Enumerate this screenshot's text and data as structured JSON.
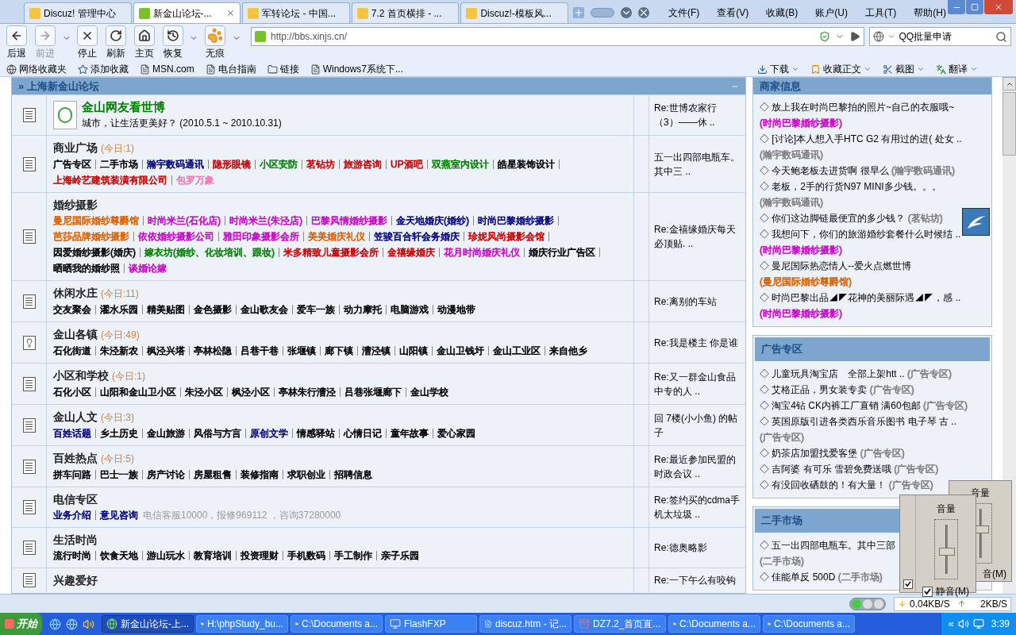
{
  "tabs": [
    {
      "label": "Discuz! 管理中心",
      "selected": false
    },
    {
      "label": "新金山论坛-...",
      "selected": true
    },
    {
      "label": "军转论坛 - 中国...",
      "selected": false
    },
    {
      "label": "7.2 首页横排 - ...",
      "selected": false
    },
    {
      "label": "Discuz!-模板风...",
      "selected": false
    }
  ],
  "menu": [
    "文件(F)",
    "查看(V)",
    "收藏(B)",
    "账户(U)",
    "工具(T)",
    "帮助(H)"
  ],
  "toolbar": [
    {
      "kind": "back",
      "label": "后退",
      "disabled": false
    },
    {
      "kind": "forward",
      "label": "前进",
      "disabled": true
    },
    {
      "kind": "stop",
      "label": "停止",
      "disabled": false
    },
    {
      "kind": "refresh",
      "label": "刷新",
      "disabled": false
    },
    {
      "kind": "home",
      "label": "主页",
      "disabled": false
    },
    {
      "kind": "restore",
      "label": "恢复",
      "disabled": false
    },
    {
      "kind": "private",
      "label": "无痕",
      "disabled": false
    }
  ],
  "address": {
    "value": "http://bbs.xinjs.cn/"
  },
  "search": {
    "value": "QQ批量申请"
  },
  "favorites_left": [
    {
      "kind": "net",
      "label": "网络收藏夹"
    },
    {
      "kind": "add",
      "label": "添加收藏"
    },
    {
      "kind": "page",
      "label": "MSN.com"
    },
    {
      "kind": "page",
      "label": "电台指南"
    },
    {
      "kind": "folder",
      "label": "链接"
    },
    {
      "kind": "page",
      "label": "Windows7系统下..."
    }
  ],
  "favorites_right": [
    {
      "kind": "download",
      "label": "下载"
    },
    {
      "kind": "save",
      "label": "收藏正文"
    },
    {
      "kind": "capture",
      "label": "截图"
    },
    {
      "kind": "translate",
      "label": "翻译"
    }
  ],
  "forum": {
    "title": "» 上海新金山论坛",
    "rows": [
      {
        "kind": "expo",
        "has_new": false,
        "title": "金山网友看世博",
        "description": "城市，让生活更美好？ (2010.5.1 ~ 2010.10.31)",
        "last_post": "Re:世博农家行（3）——休 .."
      },
      {
        "kind": "normal",
        "has_new": false,
        "title": "商业广场",
        "today": "(今日:1)",
        "last_post": "五一出四部电瓶车。其中三 ..",
        "links": [
          {
            "label": "广告专区",
            "color": "#000000"
          },
          {
            "label": "二手市场",
            "color": "#000000"
          },
          {
            "label": "瀚宇数码通讯",
            "color": "#000080"
          },
          {
            "label": "隐形眼镜",
            "color": "#cc0000"
          },
          {
            "label": "小区安防",
            "color": "#008000"
          },
          {
            "label": "茗钻坊",
            "color": "#cc0000"
          },
          {
            "label": "旅游咨询",
            "color": "#cc0000"
          },
          {
            "label": "UP酒吧",
            "color": "#cc0000"
          },
          {
            "label": "双燕室内设计",
            "color": "#008000"
          },
          {
            "label": "皓星装饰设计",
            "color": "#000000"
          },
          {
            "label": "上海岭艺建筑装潢有限公司",
            "color": "#cc0000"
          },
          {
            "label": "包罗万象",
            "color": "#e87ab5"
          }
        ]
      },
      {
        "kind": "normal",
        "has_new": false,
        "title": "婚纱摄影",
        "last_post": "Re:金禧缘婚庆每天必顶贴. ..",
        "links": [
          {
            "label": "曼尼国际婚纱尊爵馆",
            "color": "#e06000"
          },
          {
            "label": "时尚米兰(石化店)",
            "color": "#cc00cc"
          },
          {
            "label": "时尚米兰(朱泾店)",
            "color": "#cc00cc"
          },
          {
            "label": "巴黎风情婚纱摄影",
            "color": "#cc00cc"
          },
          {
            "label": "金天地婚庆(婚纱)",
            "color": "#000080"
          },
          {
            "label": "时尚巴黎婚纱摄影",
            "color": "#000080"
          },
          {
            "label": "芭莎品牌婚纱摄影",
            "color": "#e06000"
          },
          {
            "label": "依依婚纱摄影公司",
            "color": "#cc00cc"
          },
          {
            "label": "雅田印象摄影会所",
            "color": "#cc00cc"
          },
          {
            "label": "美美婚庆礼仪",
            "color": "#e06000"
          },
          {
            "label": "笠骏百合轩会务婚庆",
            "color": "#000080"
          },
          {
            "label": "珍妮风尚摄影会馆",
            "color": "#cc0000"
          },
          {
            "label": "因爱婚纱摄影(婚庆)",
            "color": "#000000"
          },
          {
            "label": "嫁衣坊(婚纱、化妆培训、跟妆)",
            "color": "#008000"
          },
          {
            "label": "米多精致儿童摄影会所",
            "color": "#cc0000"
          },
          {
            "label": "金禧缘婚庆",
            "color": "#cc0000"
          },
          {
            "label": "花月时尚婚庆礼仪",
            "color": "#cc00cc"
          },
          {
            "label": "婚庆行业广告区",
            "color": "#000000"
          },
          {
            "label": "晒晒我的婚纱照",
            "color": "#000000"
          },
          {
            "label": "谈婚论嫁",
            "color": "#cc00cc"
          }
        ]
      },
      {
        "kind": "normal",
        "has_new": false,
        "title": "休闲水庄",
        "today": "(今日:11)",
        "last_post": "Re:离别的车站",
        "links": [
          {
            "label": "交友聚会",
            "color": "#000000"
          },
          {
            "label": "濯水乐园",
            "color": "#000000"
          },
          {
            "label": "精美贴图",
            "color": "#000000"
          },
          {
            "label": "金色摄影",
            "color": "#000000"
          },
          {
            "label": "金山歌友会",
            "color": "#000000"
          },
          {
            "label": "爱车一族",
            "color": "#000000"
          },
          {
            "label": "动力摩托",
            "color": "#000000"
          },
          {
            "label": "电脑游戏",
            "color": "#000000"
          },
          {
            "label": "动漫地带",
            "color": "#000000"
          }
        ]
      },
      {
        "kind": "normal",
        "has_new": true,
        "title": "金山各镇",
        "today": "(今日:49)",
        "last_post": "Re:我是楼主 你是谁",
        "links": [
          {
            "label": "石化街道",
            "color": "#000000"
          },
          {
            "label": "朱泾新农",
            "color": "#000000"
          },
          {
            "label": "枫泾兴塔",
            "color": "#000000"
          },
          {
            "label": "亭林松隐",
            "color": "#000000"
          },
          {
            "label": "吕巷干巷",
            "color": "#000000"
          },
          {
            "label": "张堰镇",
            "color": "#000000"
          },
          {
            "label": "廊下镇",
            "color": "#000000"
          },
          {
            "label": "漕泾镇",
            "color": "#000000"
          },
          {
            "label": "山阳镇",
            "color": "#000000"
          },
          {
            "label": "金山卫钱圩",
            "color": "#000000"
          },
          {
            "label": "金山工业区",
            "color": "#000000"
          },
          {
            "label": "来自他乡",
            "color": "#000000"
          }
        ]
      },
      {
        "kind": "normal",
        "has_new": false,
        "title": "小区和学校",
        "today": "(今日:1)",
        "last_post": "Re:又一群金山食品中专的人 ..",
        "links": [
          {
            "label": "石化小区",
            "color": "#000000"
          },
          {
            "label": "山阳和金山卫小区",
            "color": "#000000"
          },
          {
            "label": "朱泾小区",
            "color": "#000000"
          },
          {
            "label": "枫泾小区",
            "color": "#000000"
          },
          {
            "label": "亭林朱行漕泾",
            "color": "#000000"
          },
          {
            "label": "吕巷张堰廊下",
            "color": "#000000"
          },
          {
            "label": "金山学校",
            "color": "#000000"
          }
        ]
      },
      {
        "kind": "normal",
        "has_new": false,
        "title": "金山人文",
        "today": "(今日:3)",
        "last_post": "回 7楼(小小鱼) 的帖子",
        "links": [
          {
            "label": "百姓话题",
            "color": "#000080"
          },
          {
            "label": "乡土历史",
            "color": "#000000"
          },
          {
            "label": "金山旅游",
            "color": "#000000"
          },
          {
            "label": "风俗与方言",
            "color": "#000000"
          },
          {
            "label": "原创文学",
            "color": "#000080"
          },
          {
            "label": "情感驿站",
            "color": "#000000"
          },
          {
            "label": "心情日记",
            "color": "#000000"
          },
          {
            "label": "童年故事",
            "color": "#000000"
          },
          {
            "label": "爱心家园",
            "color": "#000000"
          }
        ]
      },
      {
        "kind": "normal",
        "has_new": false,
        "title": "百姓热点",
        "today": "(今日:5)",
        "last_post": "Re:最近参加民盟的时政会议 ..",
        "links": [
          {
            "label": "拼车问路",
            "color": "#000000"
          },
          {
            "label": "巴士一族",
            "color": "#000000"
          },
          {
            "label": "房产讨论",
            "color": "#000000"
          },
          {
            "label": "房屋租售",
            "color": "#000000"
          },
          {
            "label": "装修指南",
            "color": "#000000"
          },
          {
            "label": "求职创业",
            "color": "#000000"
          },
          {
            "label": "招聘信息",
            "color": "#000000"
          }
        ]
      },
      {
        "kind": "normal",
        "has_new": false,
        "title": "电信专区",
        "note": "电信客服10000，报修969112 ，咨询37280000",
        "last_post": "Re:签约买的cdma手机太垃圾 ..",
        "links": [
          {
            "label": "业务介绍",
            "color": "#000080"
          },
          {
            "label": "意见咨询",
            "color": "#000080"
          }
        ]
      },
      {
        "kind": "normal",
        "has_new": false,
        "title": "生活时尚",
        "last_post": "Re:德奥略影",
        "links": [
          {
            "label": "流行时尚",
            "color": "#000000"
          },
          {
            "label": "饮食天地",
            "color": "#000000"
          },
          {
            "label": "游山玩水",
            "color": "#000000"
          },
          {
            "label": "教育培训",
            "color": "#000000"
          },
          {
            "label": "投资理财",
            "color": "#000000"
          },
          {
            "label": "手机数码",
            "color": "#000000"
          },
          {
            "label": "手工制作",
            "color": "#000000"
          },
          {
            "label": "亲子乐园",
            "color": "#000000"
          }
        ]
      },
      {
        "kind": "normal",
        "has_new": false,
        "title": "兴趣爱好",
        "last_post": "Re:一下午么有咬钩"
      }
    ]
  },
  "sidebar": [
    {
      "title": "商家信息",
      "items": [
        {
          "text": "◇ 放上我在时尚巴黎拍的照片~自己的衣服哦~",
          "source": "(时尚巴黎婚纱摄影)",
          "color": "#cc00cc"
        },
        {
          "text": "◇ [讨论]本人想入手HTC G2 有用过的进( 处女 ..",
          "source": "(瀚宇数码通讯)",
          "color": "#808080"
        },
        {
          "text": "◇ 今天鲍老板去进货啊 很早么",
          "source": "(瀚宇数码通讯)",
          "color": "#808080"
        },
        {
          "text": "◇ 老板，2手的行货N97 MINI多少钱。。。",
          "source": "(瀚宇数码通讯)",
          "color": "#808080"
        },
        {
          "text": "◇ 你们这边脚链最便宜的多少钱？",
          "source": "(茗钻坊)",
          "color": "#808080"
        },
        {
          "text": "◇ 我想问下，你们的旅游婚纱套餐什么时候结 ..",
          "source": "(时尚巴黎婚纱摄影)",
          "color": "#cc00cc"
        },
        {
          "text": "◇ 曼尼国际热恋情人--爱火点燃世博",
          "source": "(曼尼国际婚纱尊爵馆)",
          "color": "#e06000"
        },
        {
          "text": "◇ 时尚巴黎出品◢◤花神的美丽际遇◢◤，感 ..",
          "source": "(时尚巴黎婚纱摄影)",
          "color": "#cc00cc"
        }
      ]
    },
    {
      "title": "广告专区",
      "items": [
        {
          "text": "◇ 儿童玩具淘宝店　全部上架htt ..",
          "source": "(广告专区)",
          "color": "#808080"
        },
        {
          "text": "◇ 艾格正品，男女装专卖",
          "source": "(广告专区)",
          "color": "#808080"
        },
        {
          "text": "◇ 淘宝4钻 CK内裤工厂直销 满60包邮",
          "source": "(广告专区)",
          "color": "#808080"
        },
        {
          "text": "◇ 英国原版引进各类西乐音乐图书 电子琴 古 ..",
          "source": "(广告专区)",
          "color": "#808080"
        },
        {
          "text": "◇ 奶茶店加盟找爱客堡",
          "source": "(广告专区)",
          "color": "#808080"
        },
        {
          "text": "◇ 吉阿婆 有可乐 雪碧免费送哦",
          "source": "(广告专区)",
          "color": "#808080"
        },
        {
          "text": "◇ 有没回收硒鼓的！有大量！",
          "source": "(广告专区)",
          "color": "#808080"
        }
      ]
    },
    {
      "title": "二手市场",
      "items": [
        {
          "text": "◇ 五一出四部电瓶车。其中三部",
          "source": "(二手市场)",
          "color": "#808080"
        },
        {
          "text": "◇ 佳能单反 500D",
          "source": "(二手市场)",
          "color": "#808080"
        }
      ]
    }
  ],
  "volume_back": {
    "title": "音量",
    "level": 0.6,
    "mute_label": "音(M)"
  },
  "volume_front": {
    "title": "音量",
    "level": 0.45,
    "mute_label": "静音(M)",
    "muted": true,
    "side_checked": true
  },
  "status_bar": {
    "download": "0.04KB/S",
    "upload": "2KB/S"
  },
  "taskbar": {
    "start": "开始",
    "tasks": [
      {
        "kind": "browser",
        "label": "新金山论坛-上...",
        "selected": true
      },
      {
        "kind": "folder",
        "label": "H:\\phpStudy_bu...",
        "selected": false
      },
      {
        "kind": "folder",
        "label": "C:\\Documents a...",
        "selected": false
      },
      {
        "kind": "app",
        "label": "FlashFXP",
        "selected": false
      },
      {
        "kind": "note",
        "label": "discuz.htm - 记...",
        "selected": false
      },
      {
        "kind": "archive",
        "label": "DZ7.2_首页直...",
        "selected": false
      },
      {
        "kind": "folder",
        "label": "C:\\Documents a...",
        "selected": false
      },
      {
        "kind": "folder",
        "label": "C:\\Documents a...",
        "selected": false
      }
    ],
    "tray_toggle": "«",
    "clock": "3:39"
  }
}
